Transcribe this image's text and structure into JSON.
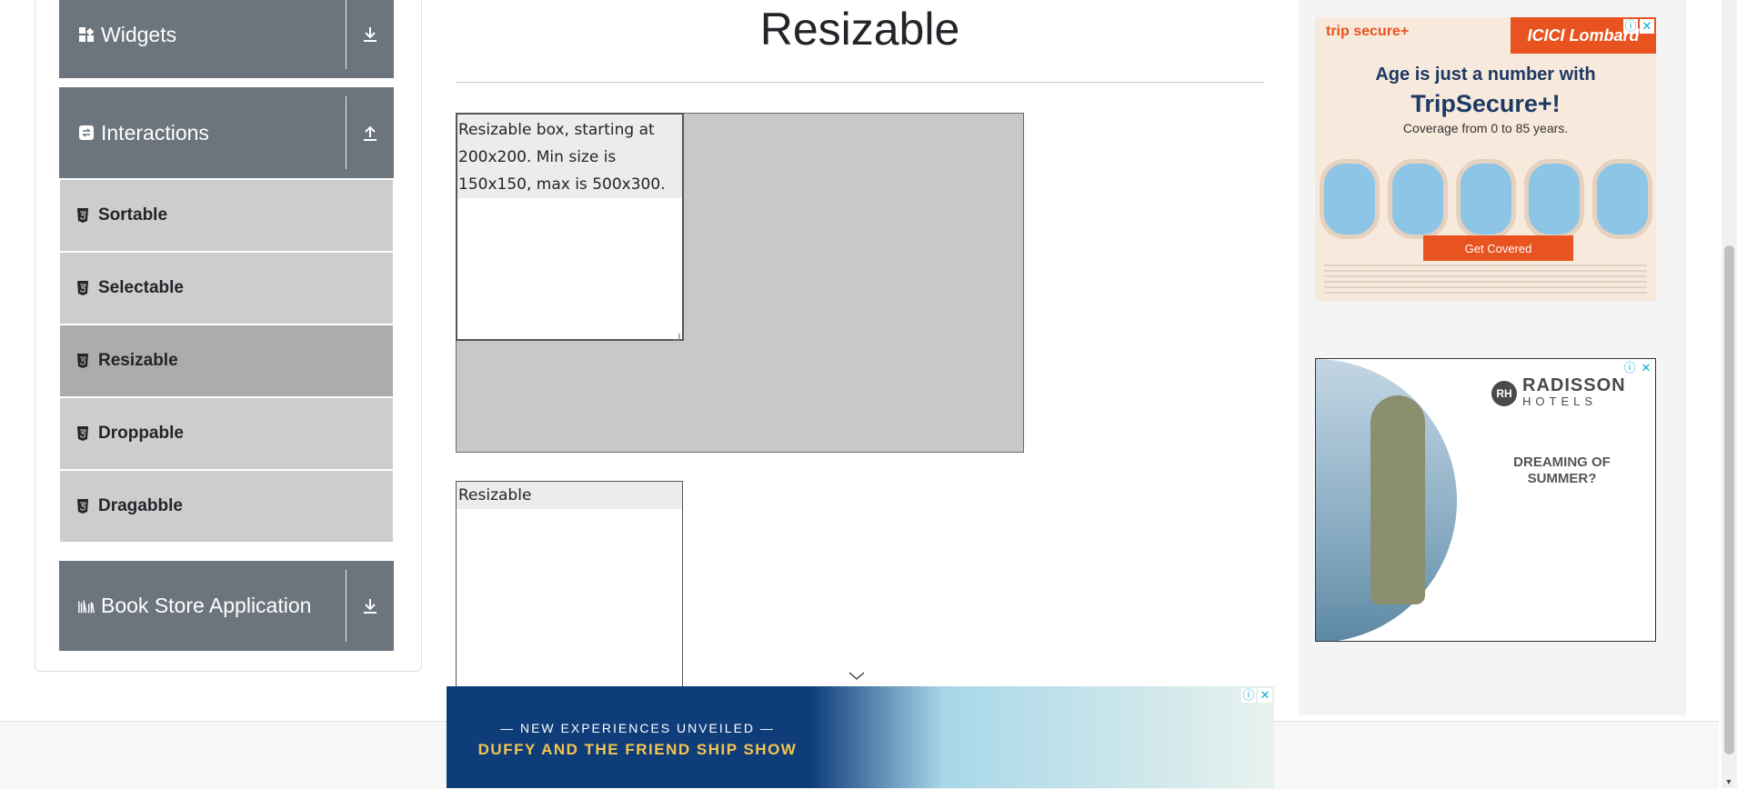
{
  "sidebar": {
    "groups": [
      {
        "label": "Widgets",
        "icon": "widgets-icon",
        "state": "collapsed"
      },
      {
        "label": "Interactions",
        "icon": "interactions-icon",
        "state": "expanded"
      },
      {
        "label": "Book Store Application",
        "icon": "book-store-icon",
        "state": "collapsed"
      }
    ],
    "items": [
      {
        "label": "Sortable",
        "active": false
      },
      {
        "label": "Selectable",
        "active": false
      },
      {
        "label": "Resizable",
        "active": true
      },
      {
        "label": "Droppable",
        "active": false
      },
      {
        "label": "Dragabble",
        "active": false
      }
    ]
  },
  "main": {
    "title": "Resizable",
    "restricted_box_text": "Resizable box, starting at 200x200. Min size is 150x150, max is 500x300.",
    "free_box_text": "Resizable"
  },
  "ads": {
    "ad1": {
      "brand_left": "trip secure+",
      "brand_right": "ICICI Lombard",
      "headline": "Age is just a number with",
      "headline2": "TripSecure+!",
      "sub": "Coverage from 0 to 85 years.",
      "cta": "Get Covered"
    },
    "ad2": {
      "logo_mark": "RH",
      "brand": "RADISSON",
      "brand_sub": "HOTELS",
      "tagline": "DREAMING OF SUMMER?"
    },
    "bottom": {
      "line1": "— NEW EXPERIENCES UNVEILED —",
      "line2": "DUFFY AND THE FRIEND SHIP SHOW"
    },
    "info_glyph": "ⓘ",
    "close_glyph": "✕"
  },
  "colors": {
    "group_header_bg": "#6c757d",
    "menu_item_bg": "#cdcdcd",
    "menu_item_active_bg": "#acacac",
    "constraint_bg": "#c8c8c8"
  }
}
